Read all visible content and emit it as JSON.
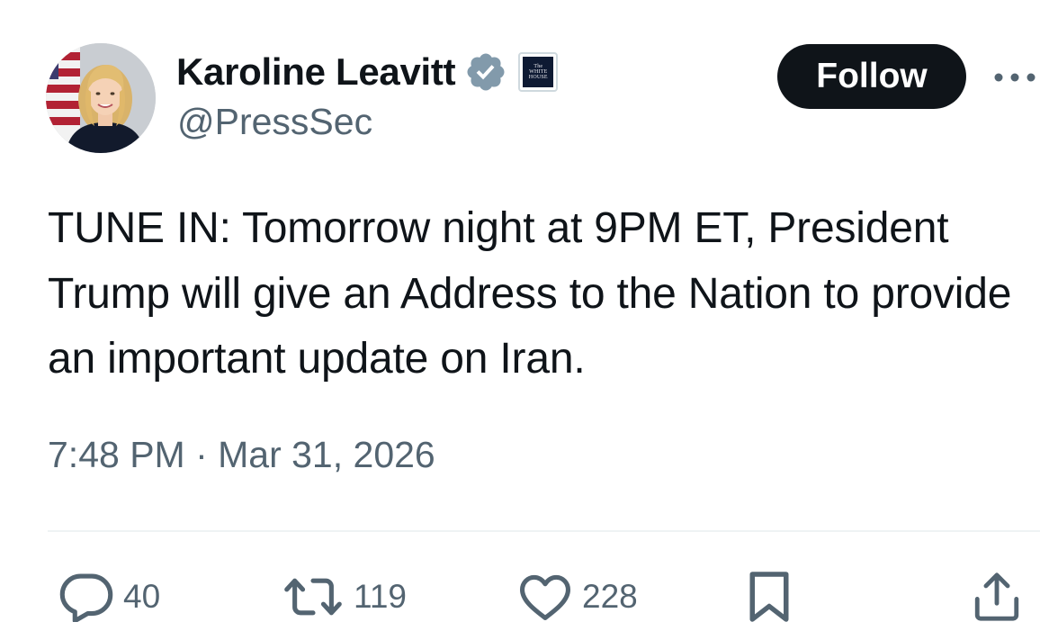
{
  "author": {
    "display_name": "Karoline Leavitt",
    "handle": "@PressSec",
    "verified_icon": "verified-badge-icon",
    "verified_color": "#829aab",
    "affiliation_badge": {
      "icon": "white-house-logo",
      "line1": "The",
      "line2": "WHITE",
      "line3": "HOUSE"
    }
  },
  "header": {
    "follow_label": "Follow",
    "more_icon": "more-options-icon"
  },
  "tweet": {
    "text": "TUNE IN: Tomorrow night at 9PM ET, President Trump will give an Address to the Nation to provide an important update on Iran.",
    "timestamp": "7:48 PM · Mar 31, 2026"
  },
  "actions": {
    "reply_count": "40",
    "retweet_count": "119",
    "like_count": "228",
    "icons": [
      "reply-icon",
      "retweet-icon",
      "like-icon",
      "bookmark-icon",
      "share-icon"
    ]
  },
  "colors": {
    "text_primary": "#0f1419",
    "text_secondary": "#536471",
    "follow_bg": "#0f1419",
    "divider": "#eff3f4"
  }
}
